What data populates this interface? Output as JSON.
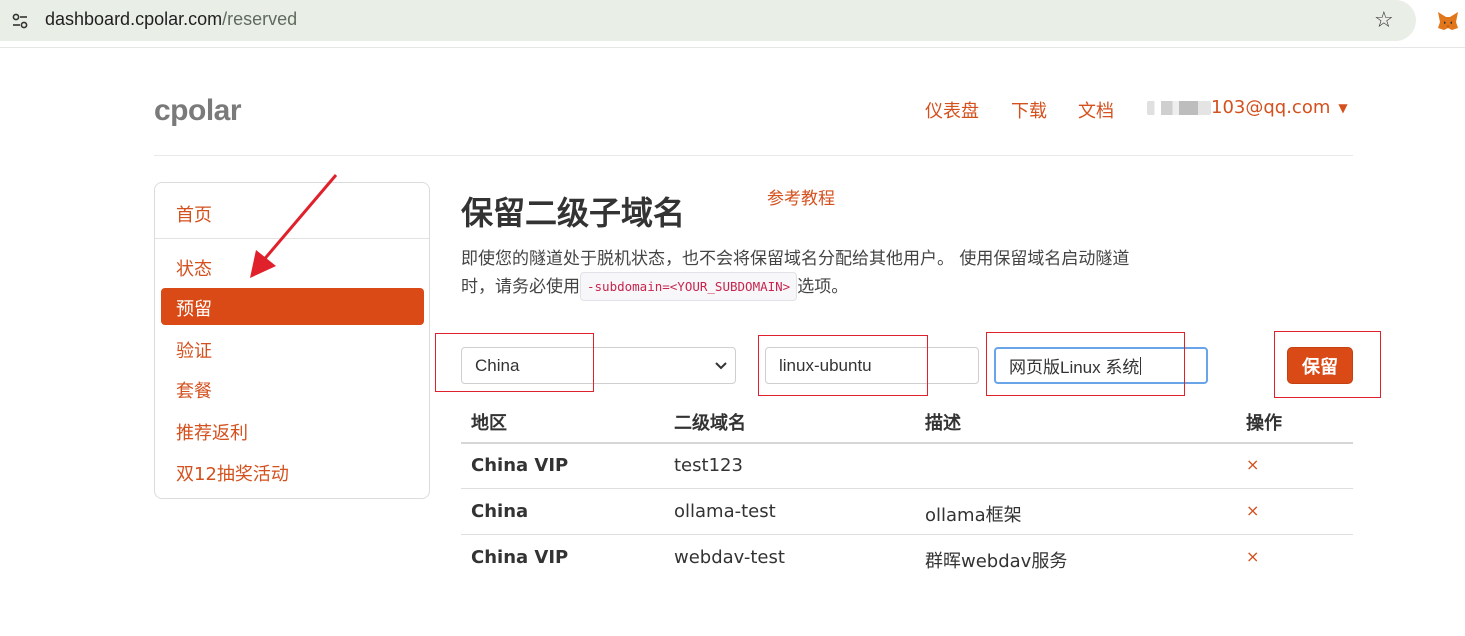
{
  "browser": {
    "url_host": "dashboard.cpolar.com",
    "url_path": "/reserved"
  },
  "header": {
    "logo": "cpolar",
    "nav": {
      "dashboard": "仪表盘",
      "download": "下载",
      "docs": "文档",
      "user_suffix": "103@qq.com"
    }
  },
  "sidebar": {
    "items": [
      "首页",
      "状态",
      "预留",
      "验证",
      "套餐",
      "推荐返利",
      "双12抽奖活动"
    ],
    "active_index": 2
  },
  "main": {
    "title": "保留二级子域名",
    "tutorial_link": "参考教程",
    "description_line1": "即使您的隧道处于脱机状态，也不会将保留域名分配给其他用户。 使用保留域名启动隧道",
    "description_line2_prefix": "时，请务必使用",
    "description_code": "-subdomain=<YOUR_SUBDOMAIN>",
    "description_line2_suffix": "选项。",
    "form": {
      "region_selected": "China",
      "subdomain_value": "linux-ubuntu",
      "description_value": "网页版Linux 系统",
      "save_label": "保留"
    },
    "table": {
      "headers": [
        "地区",
        "二级域名",
        "描述",
        "操作"
      ],
      "rows": [
        {
          "region": "China VIP",
          "subdomain": "test123",
          "description": "",
          "action": "×"
        },
        {
          "region": "China",
          "subdomain": "ollama-test",
          "description": "ollama框架",
          "action": "×"
        },
        {
          "region": "China VIP",
          "subdomain": "webdav-test",
          "description": "群晖webdav服务",
          "action": "×"
        }
      ]
    }
  },
  "colors": {
    "accent": "#d94a16",
    "link": "#d4511e",
    "annotation": "#e0202a"
  }
}
